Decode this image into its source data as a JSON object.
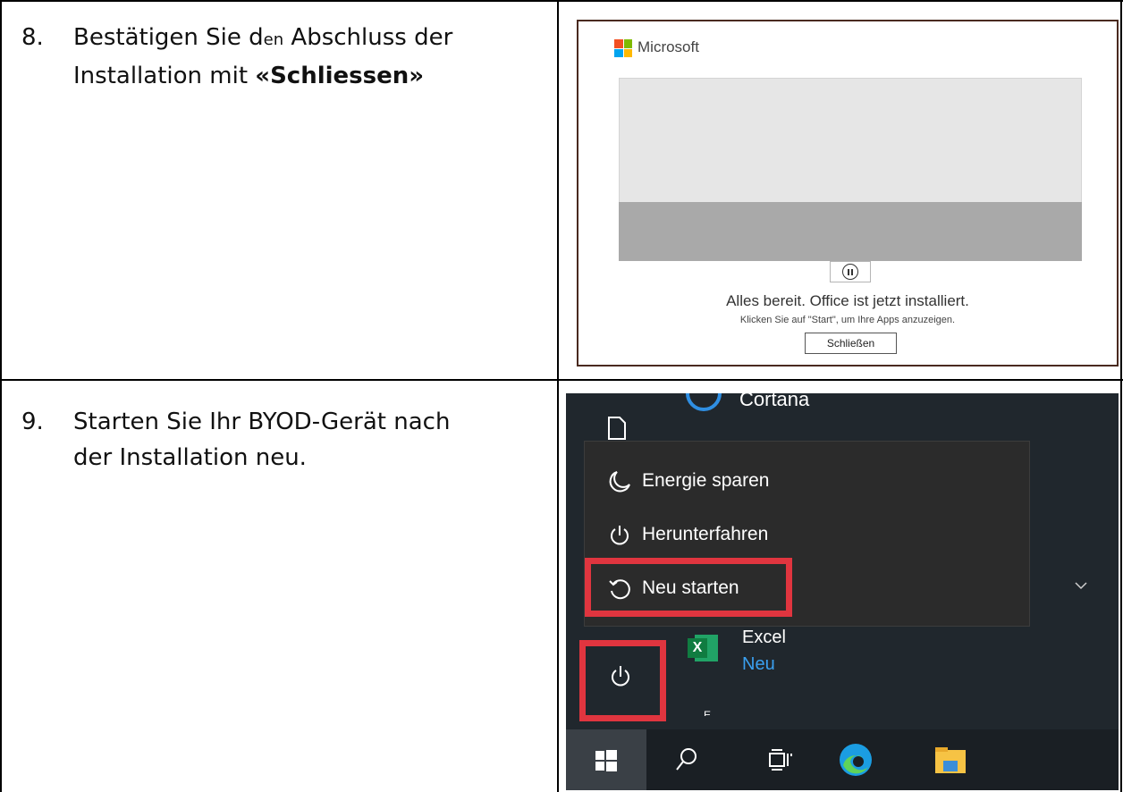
{
  "steps": [
    {
      "number": "8.",
      "text_line1_a": "Bestätigen Sie d",
      "text_line1_small": "en",
      "text_line1_b": " Abschluss der",
      "text_line2_a": "Installation mit ",
      "text_line2_bold": "«Schliessen»"
    },
    {
      "number": "9.",
      "text_line1": "Starten Sie Ihr BYOD-Gerät nach",
      "text_line2": "der Installation neu."
    }
  ],
  "office_dialog": {
    "brand": "Microsoft",
    "status": "Alles bereit. Office ist jetzt installiert.",
    "hint": "Klicken Sie auf \"Start\", um Ihre Apps anzuzeigen.",
    "close_button": "Schließen",
    "logo_colors": [
      "#f25022",
      "#7fba00",
      "#00a4ef",
      "#ffb900"
    ]
  },
  "start_menu": {
    "cortana_label": "Cortana",
    "power_items": [
      {
        "label": "Energie sparen",
        "icon": "moon-icon"
      },
      {
        "label": "Herunterfahren",
        "icon": "power-icon"
      },
      {
        "label": "Neu starten",
        "icon": "restart-icon"
      }
    ],
    "app_name": "Excel",
    "app_badge": "Neu",
    "section_letter": "E",
    "highlight_color": "#e0353f"
  }
}
